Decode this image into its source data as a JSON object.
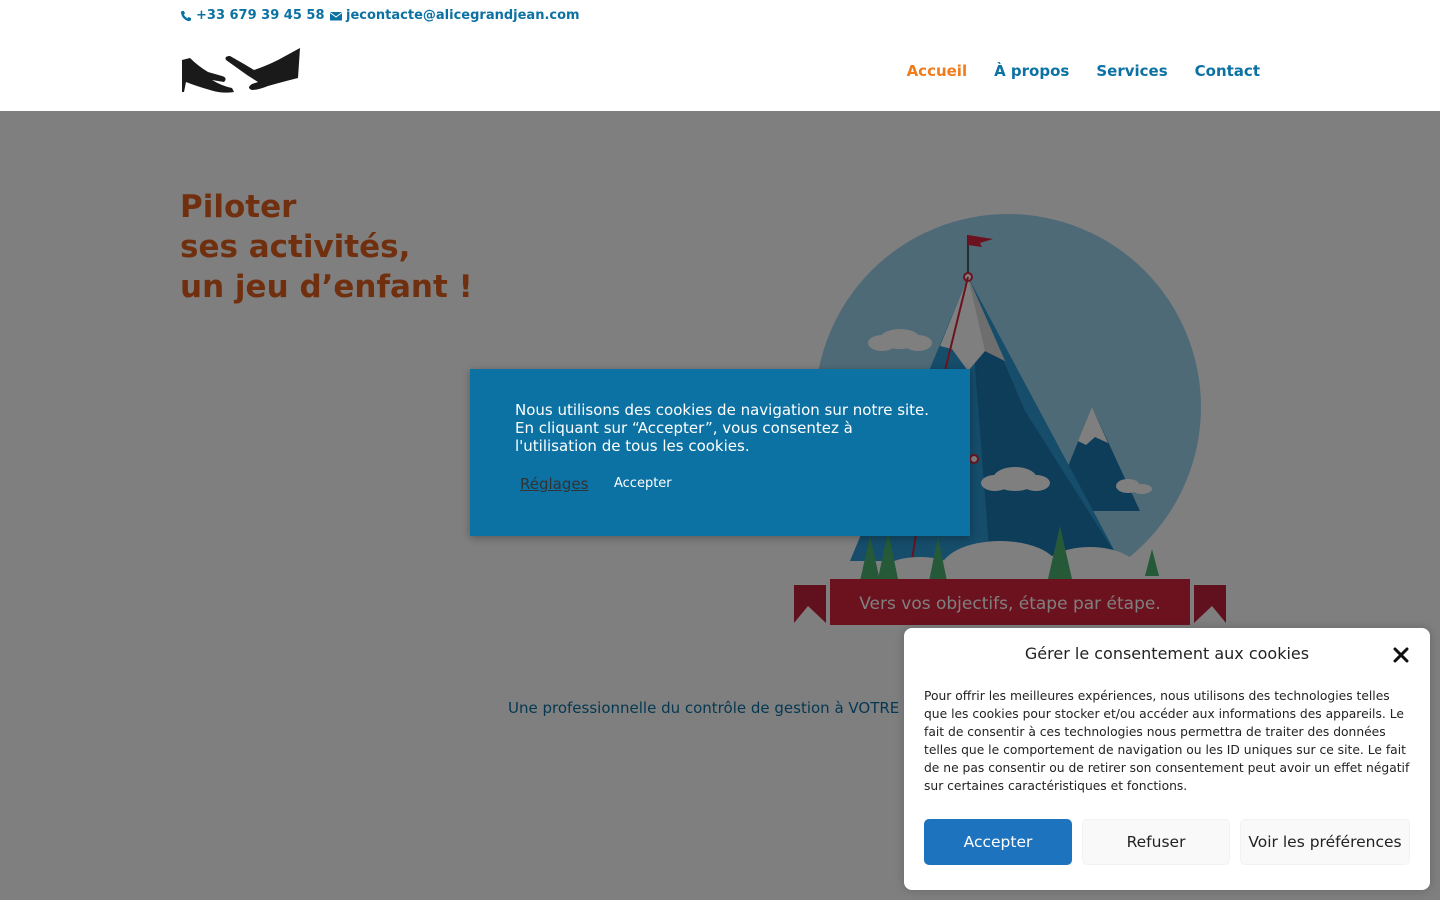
{
  "topbar": {
    "phone": "+33 679 39 45 58",
    "email": "jecontacte@alicegrandjean.com",
    "phone_icon": "phone-icon",
    "email_icon": "envelope-icon"
  },
  "header": {
    "logo": "handshake-logo",
    "nav": [
      {
        "label": "Accueil",
        "active": true
      },
      {
        "label": "À propos",
        "active": false
      },
      {
        "label": "Services",
        "active": false
      },
      {
        "label": "Contact",
        "active": false
      }
    ]
  },
  "hero": {
    "title_lines": [
      "Piloter",
      "ses activités,",
      "un jeu d’enfant !"
    ],
    "illustration_banner": "Vers vos objectifs, étape par étape.",
    "tagline": "Une professionnelle du contrôle de gestion à VOTRE serv"
  },
  "cookie_box": {
    "message": "Nous utilisons des cookies de navigation sur notre site. En cliquant sur “Accepter”, vous consentez à l'utilisation de tous les cookies.",
    "settings_label": "Réglages",
    "accept_label": "Accepter"
  },
  "consent_dialog": {
    "title": "Gérer le consentement aux cookies",
    "body": "Pour offrir les meilleures expériences, nous utilisons des technologies telles que les cookies pour stocker et/ou accéder aux informations des appareils. Le fait de consentir à ces technologies nous permettra de traiter des données telles que le comportement de navigation ou les ID uniques sur ce site. Le fait de ne pas consentir ou de retirer son consentement peut avoir un effet négatif sur certaines caractéristiques et fonctions.",
    "accept_label": "Accepter",
    "refuse_label": "Refuser",
    "prefs_label": "Voir les préférences"
  },
  "colors": {
    "brand_blue": "#0c71a3",
    "accent_orange": "#f07c1b",
    "title_orange": "#e0601e",
    "consent_accept": "#1e73be"
  }
}
